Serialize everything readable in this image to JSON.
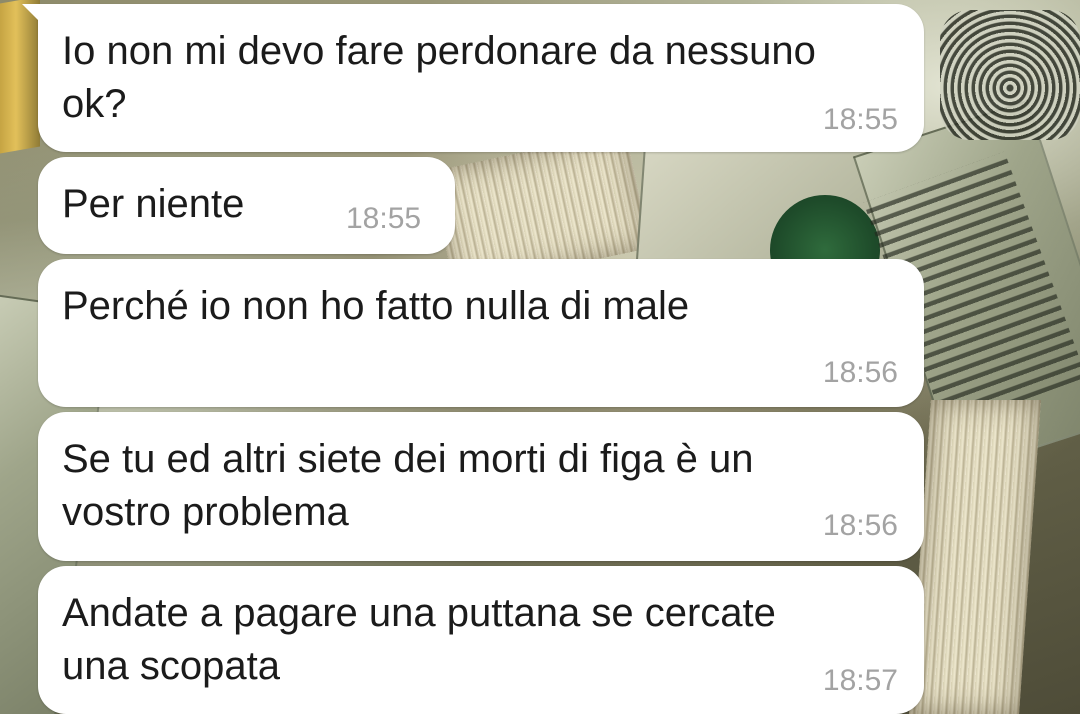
{
  "chat": {
    "messages": [
      {
        "text": "Io non mi devo fare perdonare da nessuno\nok?",
        "time": "18:55"
      },
      {
        "text": "Per niente",
        "time": "18:55"
      },
      {
        "text": "Perché io non ho fatto nulla di male",
        "time": "18:56"
      },
      {
        "text": "Se tu ed altri siete dei morti di figa è un\nvostro problema",
        "time": "18:56"
      },
      {
        "text": "Andate a pagare una puttana se cercate\nuna scopata",
        "time": "18:57"
      }
    ]
  },
  "wallpaper": {
    "description_icon": "banknotes-wallpaper-icon",
    "accent_colors": [
      "#a9a98c",
      "#2f6b3c",
      "#d9d2b4"
    ]
  },
  "colors": {
    "bubble_background": "#ffffff",
    "message_text": "#1b1b1b",
    "timestamp_text": "#a3a3a3"
  }
}
